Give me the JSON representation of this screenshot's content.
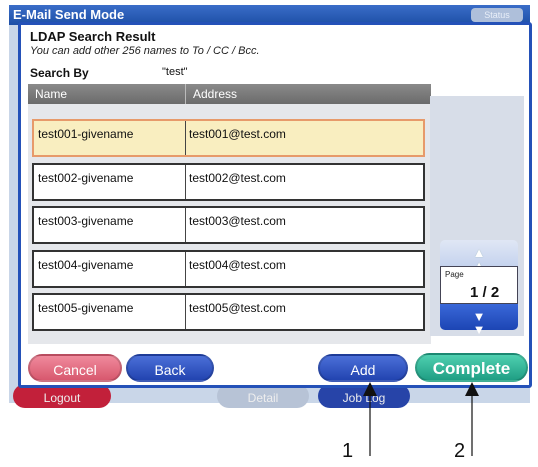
{
  "background_app": {
    "title": "E-Mail Send Mode",
    "status_button": "Status",
    "logout_button": "Logout",
    "detail_button": "Detail",
    "job_log_button": "Job Log"
  },
  "dialog": {
    "title": "LDAP Search Result",
    "subtitle": "You can add other 256 names to To / CC / Bcc.",
    "search_by_label": "Search By",
    "search_by_value": "\"test\""
  },
  "table": {
    "columns": [
      "Name",
      "Address"
    ],
    "rows": [
      {
        "name": "test001-givename",
        "address": "test001@test.com",
        "selected": true
      },
      {
        "name": "test002-givename",
        "address": "test002@test.com",
        "selected": false
      },
      {
        "name": "test003-givename",
        "address": "test003@test.com",
        "selected": false
      },
      {
        "name": "test004-givename",
        "address": "test004@test.com",
        "selected": false
      },
      {
        "name": "test005-givename",
        "address": "test005@test.com",
        "selected": false
      }
    ]
  },
  "pager": {
    "label": "Page",
    "value": "1 / 2",
    "up_icon": "double-chevron-up-icon",
    "down_icon": "double-chevron-down-icon"
  },
  "buttons": {
    "cancel": "Cancel",
    "back": "Back",
    "add": "Add",
    "complete": "Complete"
  },
  "callouts": [
    "1",
    "2"
  ],
  "colors": {
    "dialog_border": "#2451b8",
    "selected_row": "#f9eec0",
    "cancel": "#e06a80",
    "blue_button": "#2f55c2",
    "complete": "#2db598"
  }
}
